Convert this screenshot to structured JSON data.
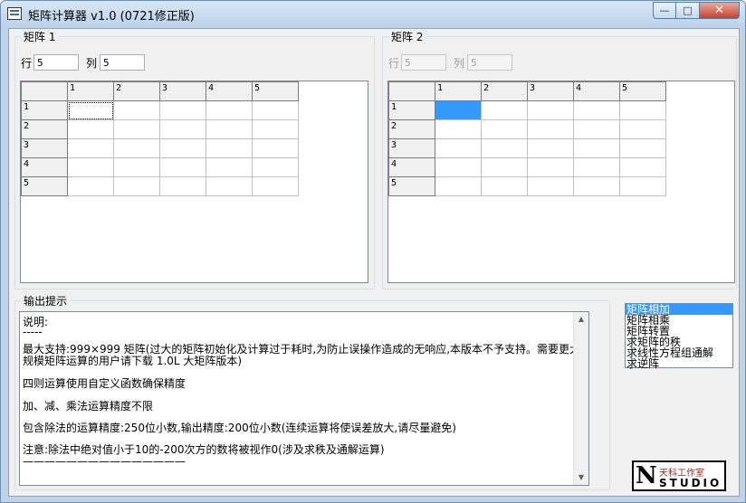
{
  "window": {
    "title": "矩阵计算器 v1.0 (0721修正版)",
    "controls": {
      "minimize": "—",
      "maximize": "□",
      "close": "✕"
    }
  },
  "matrix1": {
    "title": "矩阵 1",
    "rows_label": "行",
    "rows_value": "5",
    "cols_label": "列",
    "cols_value": "5",
    "col_headers": [
      "1",
      "2",
      "3",
      "4",
      "5"
    ],
    "row_headers": [
      "1",
      "2",
      "3",
      "4",
      "5"
    ]
  },
  "matrix2": {
    "title": "矩阵 2",
    "rows_label": "行",
    "rows_value": "5",
    "cols_label": "列",
    "cols_value": "5",
    "col_headers": [
      "1",
      "2",
      "3",
      "4",
      "5"
    ],
    "row_headers": [
      "1",
      "2",
      "3",
      "4",
      "5"
    ]
  },
  "output": {
    "title": "输出提示",
    "lines": [
      "说明:",
      "-----",
      "最大支持:999×999 矩阵(过大的矩阵初始化及计算过于耗时,为防止误操作造成的无响应,本版本不予支持。需要更大",
      "规模矩阵运算的用户请下载 1.0L 大矩阵版本)",
      "四则运算使用自定义函数确保精度",
      "加、减、乘法运算精度不限",
      "包含除法的运算精度:250位小数,输出精度:200位小数(连续运算将使误差放大,请尽量避免)",
      "注意:除法中绝对值小于10的-200次方的数将被视作0(涉及求秩及通解运算)",
      "———————————————"
    ]
  },
  "operations": {
    "items": [
      "矩阵相加",
      "矩阵相乘",
      "矩阵转置",
      "求矩阵的秩",
      "求线性方程组通解",
      "求逆阵"
    ],
    "selected_index": 0
  },
  "logo": {
    "letter": "N",
    "top_text": "天科工作室",
    "bottom_text": "STUDIO"
  },
  "icons": {
    "app": "matrix-app-icon",
    "scroll_up": "▲",
    "scroll_down": "▼"
  }
}
